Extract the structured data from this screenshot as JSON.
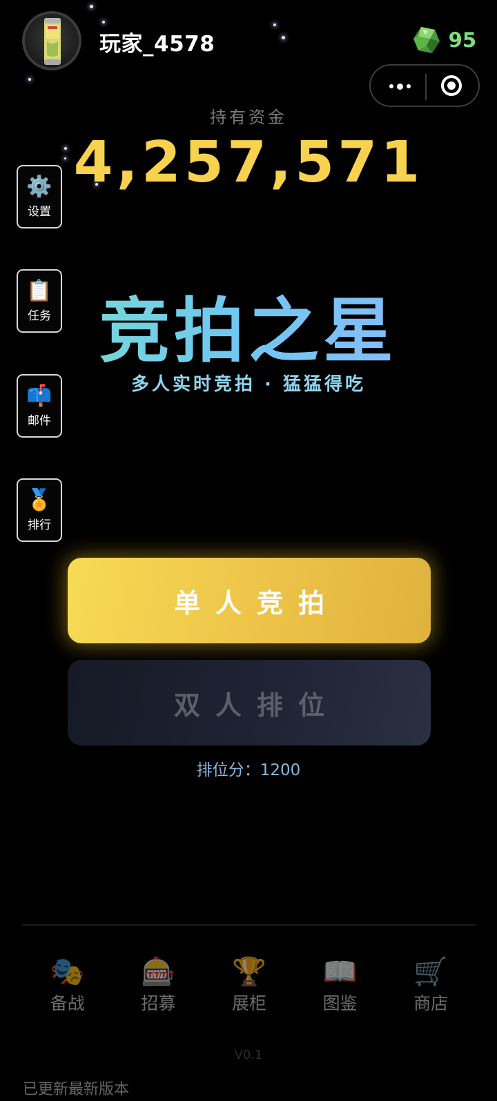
{
  "header": {
    "username": "玩家_4578",
    "gem_count": "95",
    "gem_icon": "green-gem-icon",
    "avatar_icon": "drink-can-avatar",
    "capsule": {
      "more_icon": "more-dots-icon",
      "close_icon": "target-icon"
    }
  },
  "funds": {
    "label": "持有资金",
    "value": "4,257,571"
  },
  "side_menu": [
    {
      "icon": "⚙️",
      "icon_name": "gear-icon",
      "label": "设置"
    },
    {
      "icon": "📋",
      "icon_name": "clipboard-icon",
      "label": "任务"
    },
    {
      "icon": "📫",
      "icon_name": "mailbox-icon",
      "label": "邮件"
    },
    {
      "icon": "🏅",
      "icon_name": "medal-icon",
      "label": "排行"
    }
  ],
  "title": {
    "main": "竞拍之星",
    "subtitle": "多人实时竞拍 · 猛猛得吃"
  },
  "buttons": {
    "solo_label": "单人竞拍",
    "duo_label": "双人排位",
    "rank_score": "排位分：1200"
  },
  "bottom_nav": [
    {
      "icon": "🎭",
      "icon_name": "masks-icon",
      "label": "备战"
    },
    {
      "icon": "🎰",
      "icon_name": "slot-machine-icon",
      "label": "招募"
    },
    {
      "icon": "🏆",
      "icon_name": "trophy-icon",
      "label": "展柜"
    },
    {
      "icon": "📖",
      "icon_name": "book-icon",
      "label": "图鉴"
    },
    {
      "icon": "🛒",
      "icon_name": "cart-icon",
      "label": "商店"
    }
  ],
  "footer": {
    "version": "V0.1",
    "update_note": "已更新最新版本"
  },
  "colors": {
    "background": "#000000",
    "funds": "#f7d24f",
    "gem_count": "#7be07c",
    "solo_button": "#f0c84b",
    "duo_button": "#1e2232",
    "rank_score": "#8ab7e0"
  }
}
